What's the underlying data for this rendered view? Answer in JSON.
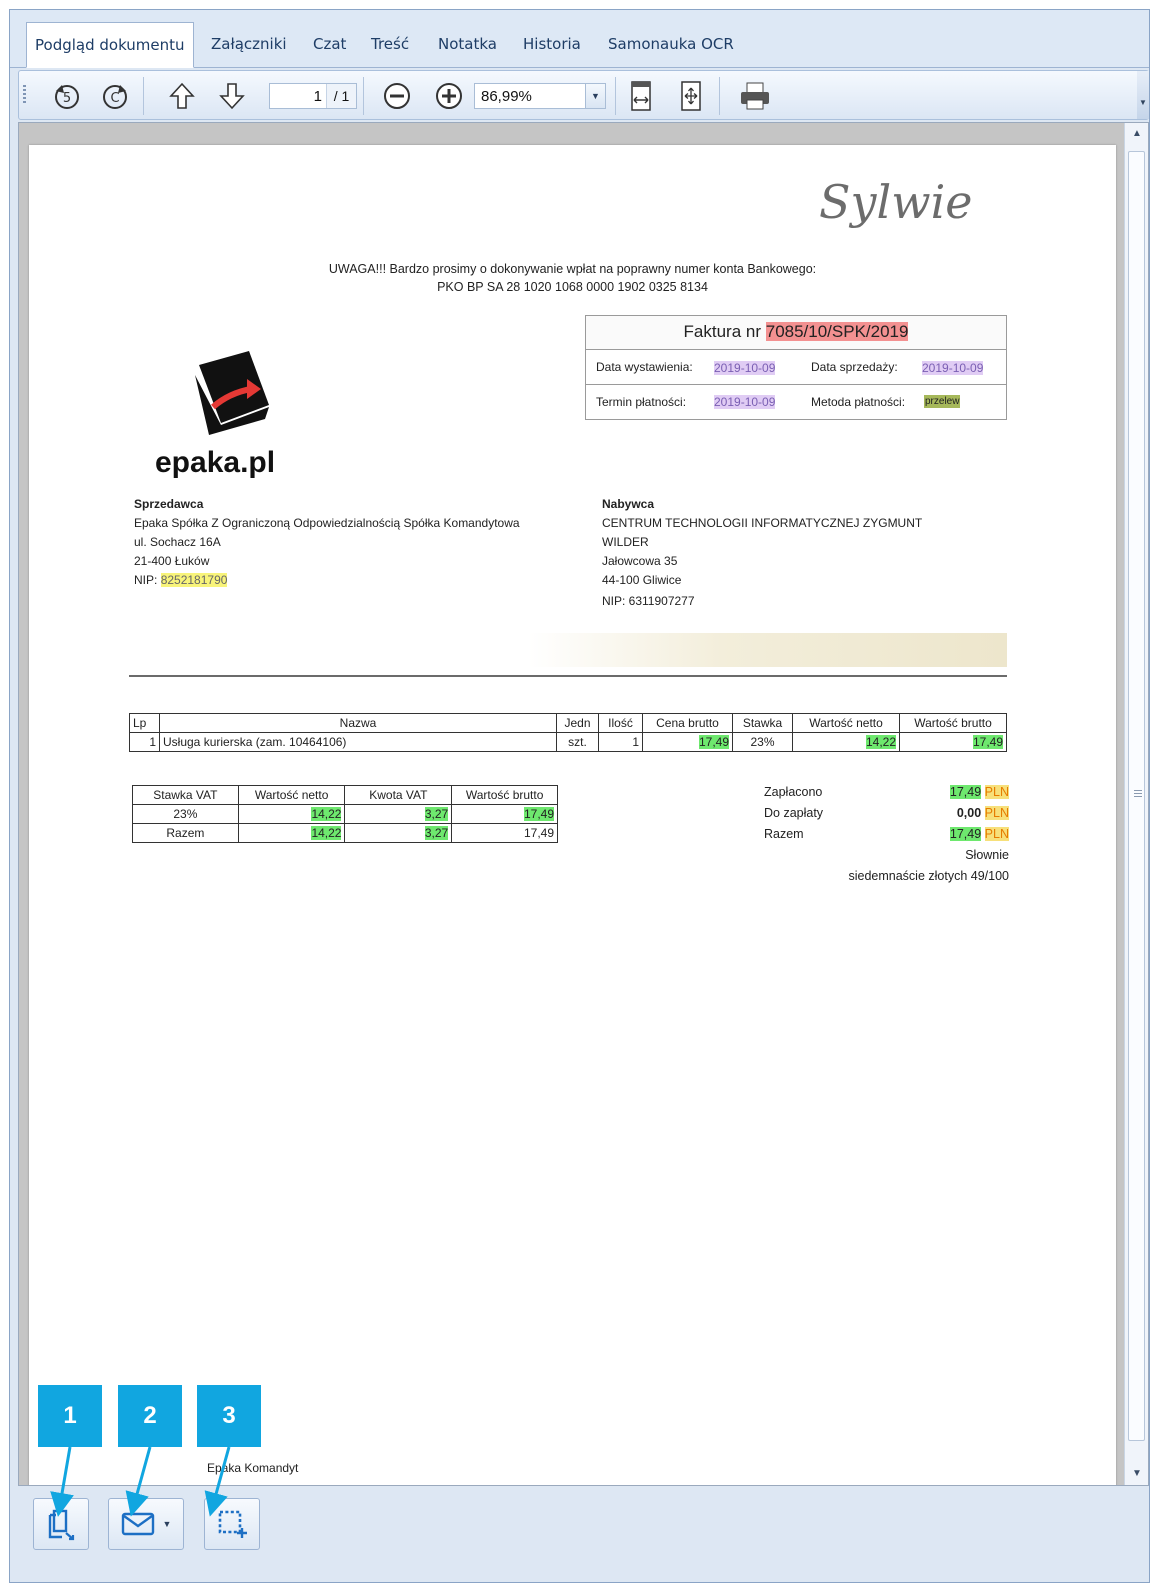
{
  "tabs": [
    {
      "label": "Podgląd dokumentu",
      "active": true
    },
    {
      "label": "Załączniki"
    },
    {
      "label": "Czat"
    },
    {
      "label": "Treść"
    },
    {
      "label": "Notatka"
    },
    {
      "label": "Historia"
    },
    {
      "label": "Samonauka OCR"
    }
  ],
  "toolbar": {
    "page_current": "1",
    "page_total": "/ 1",
    "zoom": "86,99%",
    "icons": [
      "rotate-left-icon",
      "rotate-right-icon",
      "arrow-up-icon",
      "arrow-down-icon",
      "zoom-out-icon",
      "zoom-in-icon",
      "fit-width-icon",
      "fit-page-icon",
      "print-icon"
    ]
  },
  "document": {
    "signature": "Sylwie",
    "notice_line1": "UWAGA!!! Bardzo prosimy o dokonywanie wpłat na poprawny numer konta Bankowego:",
    "notice_line2": "PKO BP SA 28 1020 1068 0000 1902 0325 8134",
    "logo_text": "epaka.pl",
    "invoice_title_prefix": "Faktura nr",
    "invoice_number": "7085/10/SPK/2019",
    "issue_date_label": "Data wystawienia:",
    "issue_date": "2019-10-09",
    "sale_date_label": "Data sprzedaży:",
    "sale_date": "2019-10-09",
    "due_date_label": "Termin płatności:",
    "due_date": "2019-10-09",
    "payment_method_label": "Metoda płatności:",
    "payment_method": "przelew",
    "seller": {
      "heading": "Sprzedawca",
      "name": "Epaka Spółka Z Ograniczoną Odpowiedzialnością Spółka Komandytowa",
      "street": "ul. Sochacz 16A",
      "city": "21-400 Łuków",
      "nip_label": "NIP:",
      "nip": "8252181790"
    },
    "buyer": {
      "heading": "Nabywca",
      "name_line1": "CENTRUM TECHNOLOGII INFORMATYCZNEJ ZYGMUNT",
      "name_line2": "WILDER",
      "street": "Jałowcowa 35",
      "city": "44-100 Gliwice",
      "nip": "NIP: 6311907277"
    },
    "items_headers": [
      "Lp",
      "Nazwa",
      "Jedn",
      "Ilość",
      "Cena brutto",
      "Stawka",
      "Wartość netto",
      "Wartość brutto"
    ],
    "items": [
      [
        "1",
        "Usługa kurierska (zam. 10464106)",
        "szt.",
        "1",
        "17,49",
        "23%",
        "14,22",
        "17,49"
      ]
    ],
    "vat_headers": [
      "Stawka VAT",
      "Wartość netto",
      "Kwota VAT",
      "Wartość brutto"
    ],
    "vat_rows": [
      [
        "23%",
        "14,22",
        "3,27",
        "17,49"
      ],
      [
        "Razem",
        "14,22",
        "3,27",
        "17,49"
      ]
    ],
    "summary": {
      "paid_label": "Zapłacono",
      "paid_value": "17,49",
      "due_label": "Do zapłaty",
      "due_value": "0,00",
      "total_label": "Razem",
      "total_value": "17,49",
      "currency": "PLN",
      "words_label": "Słownie",
      "words": "siedemnaście złotych 49/100"
    },
    "footer_text": "Epaka Komandyt"
  },
  "markers": [
    "1",
    "2",
    "3"
  ],
  "bottom_buttons": [
    "split-document-icon",
    "email-icon",
    "select-region-icon"
  ],
  "colors": {
    "marker_blue": "#11a6e0",
    "highlight_green": "#6ee86e",
    "highlight_red": "#f39191",
    "highlight_purple": "#e0ccf4",
    "highlight_yellow": "#f8f47a"
  }
}
